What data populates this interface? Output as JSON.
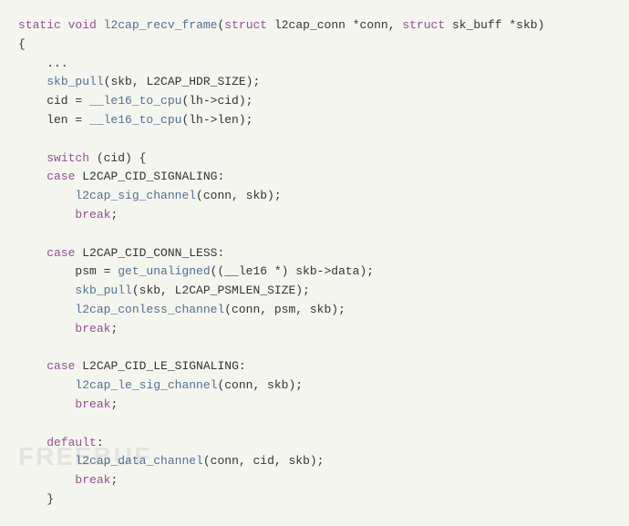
{
  "code": {
    "lines": [
      {
        "id": "l1",
        "tokens": [
          {
            "t": "kw-type",
            "v": "static"
          },
          {
            "t": "plain",
            "v": " "
          },
          {
            "t": "kw-type",
            "v": "void"
          },
          {
            "t": "plain",
            "v": " "
          },
          {
            "t": "fn",
            "v": "l2cap_recv_frame"
          },
          {
            "t": "plain",
            "v": "("
          },
          {
            "t": "kw-type",
            "v": "struct"
          },
          {
            "t": "plain",
            "v": " l2cap_conn *conn, "
          },
          {
            "t": "kw-type",
            "v": "struct"
          },
          {
            "t": "plain",
            "v": " sk_buff *skb)"
          }
        ]
      },
      {
        "id": "l2",
        "tokens": [
          {
            "t": "plain",
            "v": "{"
          }
        ]
      },
      {
        "id": "l3",
        "tokens": [
          {
            "t": "plain",
            "v": "    ..."
          }
        ]
      },
      {
        "id": "l4",
        "tokens": [
          {
            "t": "plain",
            "v": "    "
          },
          {
            "t": "fn",
            "v": "skb_pull"
          },
          {
            "t": "plain",
            "v": "(skb, L2CAP_HDR_SIZE);"
          }
        ]
      },
      {
        "id": "l5",
        "tokens": [
          {
            "t": "plain",
            "v": "    cid = "
          },
          {
            "t": "fn",
            "v": "__le16_to_cpu"
          },
          {
            "t": "plain",
            "v": "(lh->cid);"
          }
        ]
      },
      {
        "id": "l6",
        "tokens": [
          {
            "t": "plain",
            "v": "    len = "
          },
          {
            "t": "fn",
            "v": "__le16_to_cpu"
          },
          {
            "t": "plain",
            "v": "(lh->len);"
          }
        ]
      },
      {
        "id": "l7",
        "tokens": []
      },
      {
        "id": "l8",
        "tokens": [
          {
            "t": "plain",
            "v": "    "
          },
          {
            "t": "kw-ctrl",
            "v": "switch"
          },
          {
            "t": "plain",
            "v": " (cid) {"
          }
        ]
      },
      {
        "id": "l9",
        "tokens": [
          {
            "t": "plain",
            "v": "    "
          },
          {
            "t": "kw-ctrl",
            "v": "case"
          },
          {
            "t": "plain",
            "v": " L2CAP_CID_SIGNALING:"
          }
        ]
      },
      {
        "id": "l10",
        "tokens": [
          {
            "t": "plain",
            "v": "        "
          },
          {
            "t": "fn",
            "v": "l2cap_sig_channel"
          },
          {
            "t": "plain",
            "v": "(conn, skb);"
          }
        ]
      },
      {
        "id": "l11",
        "tokens": [
          {
            "t": "plain",
            "v": "        "
          },
          {
            "t": "kw-ctrl",
            "v": "break"
          },
          {
            "t": "plain",
            "v": ";"
          }
        ]
      },
      {
        "id": "l12",
        "tokens": []
      },
      {
        "id": "l13",
        "tokens": [
          {
            "t": "plain",
            "v": "    "
          },
          {
            "t": "kw-ctrl",
            "v": "case"
          },
          {
            "t": "plain",
            "v": " L2CAP_CID_CONN_LESS:"
          }
        ]
      },
      {
        "id": "l14",
        "tokens": [
          {
            "t": "plain",
            "v": "        psm = "
          },
          {
            "t": "fn",
            "v": "get_unaligned"
          },
          {
            "t": "plain",
            "v": "((__le16 *) skb->data);"
          }
        ]
      },
      {
        "id": "l15",
        "tokens": [
          {
            "t": "plain",
            "v": "        "
          },
          {
            "t": "fn",
            "v": "skb_pull"
          },
          {
            "t": "plain",
            "v": "(skb, L2CAP_PSMLEN_SIZE);"
          }
        ]
      },
      {
        "id": "l16",
        "tokens": [
          {
            "t": "plain",
            "v": "        "
          },
          {
            "t": "fn",
            "v": "l2cap_conless_channel"
          },
          {
            "t": "plain",
            "v": "(conn, psm, skb);"
          }
        ]
      },
      {
        "id": "l17",
        "tokens": [
          {
            "t": "plain",
            "v": "        "
          },
          {
            "t": "kw-ctrl",
            "v": "break"
          },
          {
            "t": "plain",
            "v": ";"
          }
        ]
      },
      {
        "id": "l18",
        "tokens": []
      },
      {
        "id": "l19",
        "tokens": [
          {
            "t": "plain",
            "v": "    "
          },
          {
            "t": "kw-ctrl",
            "v": "case"
          },
          {
            "t": "plain",
            "v": " L2CAP_CID_LE_SIGNALING:"
          }
        ]
      },
      {
        "id": "l20",
        "tokens": [
          {
            "t": "plain",
            "v": "        "
          },
          {
            "t": "fn",
            "v": "l2cap_le_sig_channel"
          },
          {
            "t": "plain",
            "v": "(conn, skb);"
          }
        ]
      },
      {
        "id": "l21",
        "tokens": [
          {
            "t": "plain",
            "v": "        "
          },
          {
            "t": "kw-ctrl",
            "v": "break"
          },
          {
            "t": "plain",
            "v": ";"
          }
        ]
      },
      {
        "id": "l22",
        "tokens": []
      },
      {
        "id": "l23",
        "tokens": [
          {
            "t": "plain",
            "v": "    "
          },
          {
            "t": "kw-ctrl",
            "v": "default"
          },
          {
            "t": "plain",
            "v": ":"
          }
        ]
      },
      {
        "id": "l24",
        "tokens": [
          {
            "t": "plain",
            "v": "        "
          },
          {
            "t": "fn",
            "v": "l2cap_data_channel"
          },
          {
            "t": "plain",
            "v": "(conn, cid, skb);"
          }
        ]
      },
      {
        "id": "l25",
        "tokens": [
          {
            "t": "plain",
            "v": "        "
          },
          {
            "t": "kw-ctrl",
            "v": "break"
          },
          {
            "t": "plain",
            "v": ";"
          }
        ]
      },
      {
        "id": "l26",
        "tokens": [
          {
            "t": "plain",
            "v": "    }"
          }
        ]
      }
    ],
    "watermark": "FREEBUF"
  }
}
